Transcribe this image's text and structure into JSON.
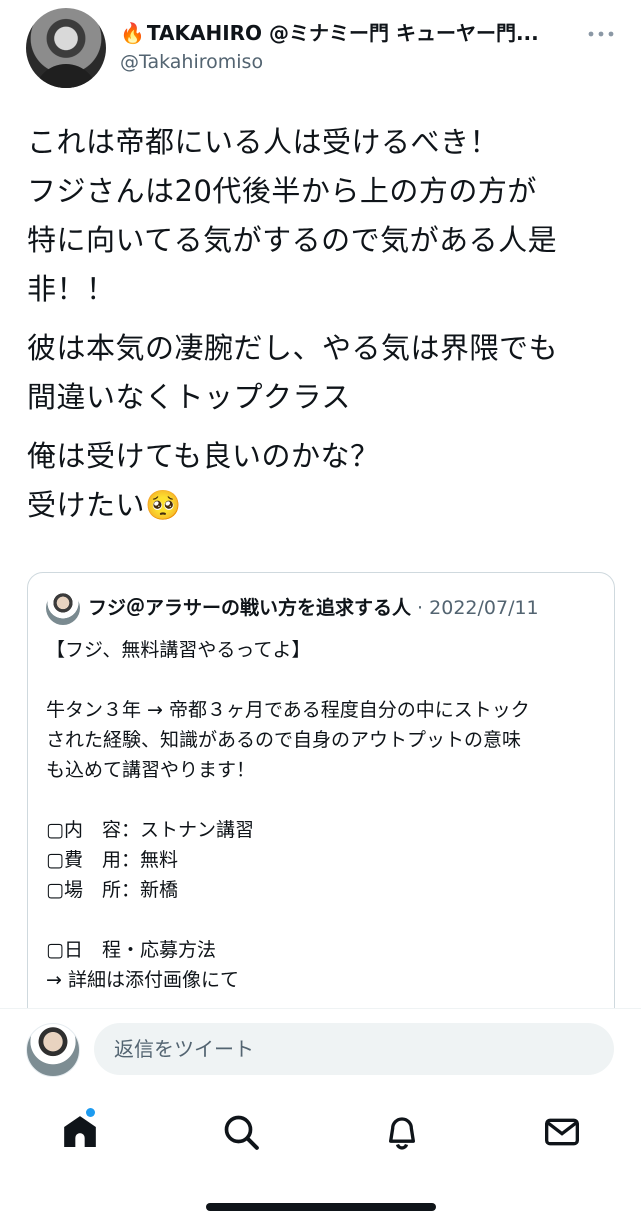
{
  "author": {
    "name": "TAKAHIRO @ミナミー門 キューヤー門...",
    "fire_emoji": "🔥",
    "handle": "@Takahiromiso"
  },
  "tweet": {
    "paragraphs": [
      "これは帝都にいる人は受けるべき！\nフジさんは20代後半から上の方の方が\n特に向いてる気がするので気がある人是\n非！！",
      "彼は本気の凄腕だし、やる気は界隈でも\n間違いなくトップクラス",
      "俺は受けても良いのかな？\n受けたい🥺"
    ]
  },
  "quote": {
    "name": "フジ＠アラサーの戦い方を追求する人",
    "separator": " · ",
    "date": "2022/07/11",
    "lines": [
      "【フジ、無料講習やるってよ】",
      "",
      "牛タン３年 → 帝都３ヶ月である程度自分の中にストック",
      "された経験、知識があるので自身のアウトプットの意味",
      "も込めて講習やります！",
      "",
      "▢内　容：ストナン講習",
      "▢費　用：無料",
      "▢場　所：新橋",
      "",
      "▢日　程・応募方法",
      "→ 詳細は添付画像にて"
    ]
  },
  "reply": {
    "placeholder": "返信をツイート"
  },
  "tabs": {
    "home": "home-icon",
    "search": "search-icon",
    "notifications": "bell-icon",
    "messages": "mail-icon",
    "accent_color": "#1d9bf0"
  }
}
